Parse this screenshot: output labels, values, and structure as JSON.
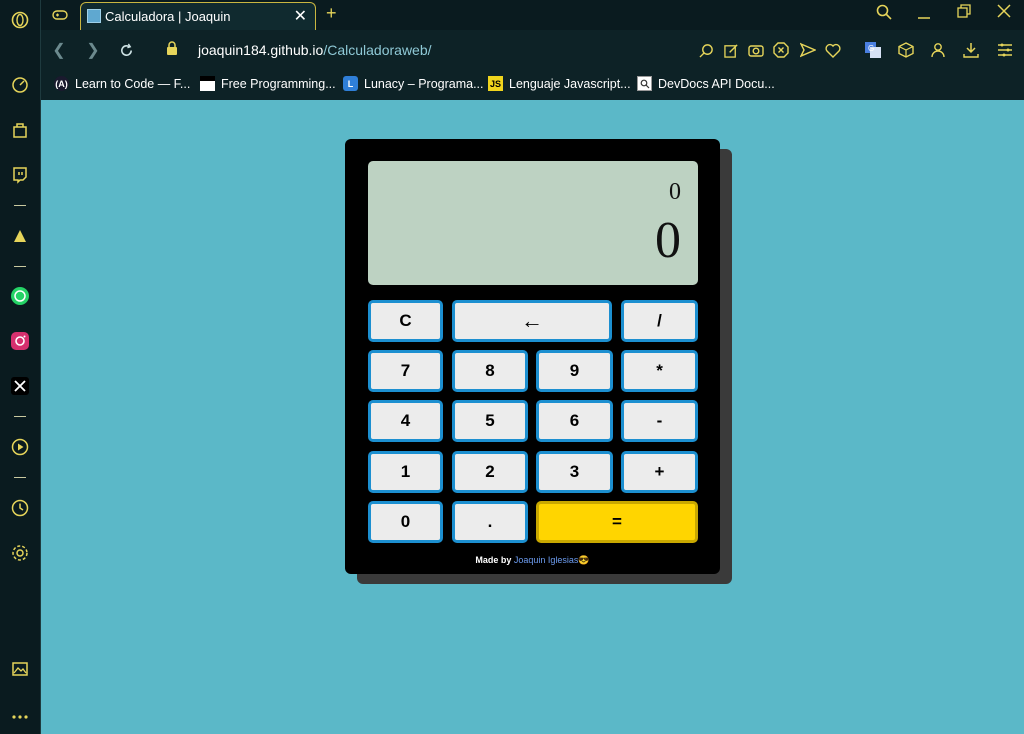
{
  "browser": {
    "tab": {
      "title": "Calculadora | Joaquin"
    },
    "url": {
      "host": "joaquin184.github.io",
      "path": "/Calculadoraweb/"
    },
    "bookmarks": [
      {
        "label": "Learn to Code — F...",
        "icon": "A"
      },
      {
        "label": "Free Programming...",
        "icon": ""
      },
      {
        "label": "Lunacy – Programa...",
        "icon": "L"
      },
      {
        "label": "Lenguaje Javascript...",
        "icon": "JS"
      },
      {
        "label": "DevDocs API Docu...",
        "icon": ""
      }
    ]
  },
  "calculator": {
    "display": {
      "previous": "0",
      "current": "0"
    },
    "keys": {
      "clear": "C",
      "backspace": "←",
      "divide": "/",
      "seven": "7",
      "eight": "8",
      "nine": "9",
      "multiply": "*",
      "four": "4",
      "five": "5",
      "six": "6",
      "minus": "-",
      "one": "1",
      "two": "2",
      "three": "3",
      "plus": "+",
      "zero": "0",
      "dot": ".",
      "equals": "="
    },
    "footer": {
      "prefix": "Made by",
      "author": "Joaquin Iglesias",
      "emoji": "😎"
    }
  },
  "colors": {
    "page_bg": "#5bb8c8",
    "calculator_bg": "#000000",
    "display_bg": "#bdd2c2",
    "key_border": "#1c8fd0",
    "equals_bg": "#ffd500",
    "browser_accent": "#e6d55a"
  }
}
